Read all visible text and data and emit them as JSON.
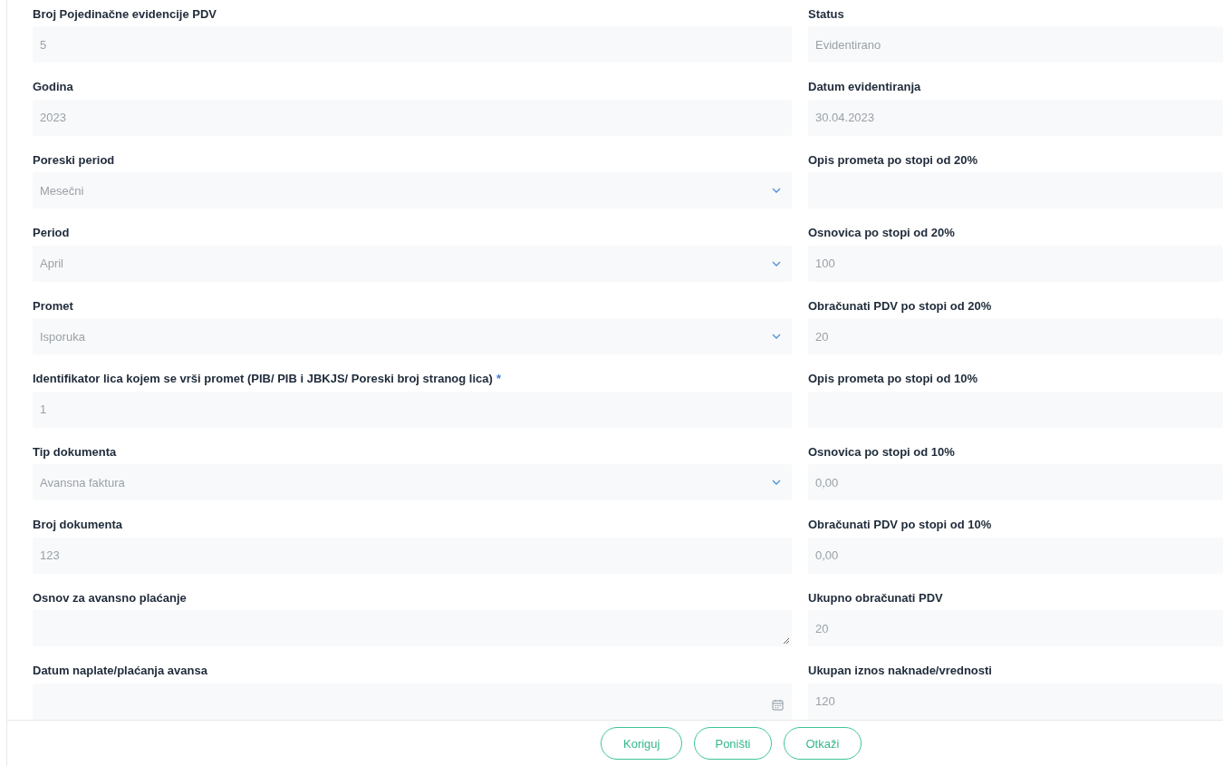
{
  "left_fields": [
    {
      "label": "Broj Pojedinačne evidencije PDV",
      "kind": "text",
      "value": "5"
    },
    {
      "label": "Godina",
      "kind": "text",
      "value": "2023"
    },
    {
      "label": "Poreski period",
      "kind": "select",
      "value": "Mesečni"
    },
    {
      "label": "Period",
      "kind": "select",
      "value": "April"
    },
    {
      "label": "Promet",
      "kind": "select",
      "value": "Isporuka"
    },
    {
      "label": "Identifikator lica kojem se vrši promet (PIB/ PIB i JBKJS/ Poreski broj stranog lica)",
      "required_mark": "*",
      "kind": "text",
      "value": "1"
    },
    {
      "label": "Tip dokumenta",
      "kind": "select",
      "value": "Avansna faktura"
    },
    {
      "label": "Broj dokumenta",
      "kind": "text",
      "value": "123"
    },
    {
      "label": "Osnov za avansno plaćanje",
      "kind": "textarea"
    },
    {
      "label": "Datum naplate/plaćanja avansa",
      "kind": "date"
    }
  ],
  "right_fields": [
    {
      "label": "Status",
      "kind": "text",
      "value": "Evidentirano"
    },
    {
      "label": "Datum evidentiranja",
      "kind": "text",
      "value": "30.04.2023"
    },
    {
      "label": "Opis prometa po stopi od 20%",
      "kind": "text"
    },
    {
      "label": "Osnovica po stopi od 20%",
      "kind": "text",
      "value": "100"
    },
    {
      "label": "Obračunati PDV po stopi od 20%",
      "kind": "text",
      "value": "20"
    },
    {
      "label": "Opis prometa po stopi od 10%",
      "kind": "text"
    },
    {
      "label": "Osnovica po stopi od 10%",
      "kind": "text",
      "value": "0,00"
    },
    {
      "label": "Obračunati PDV po stopi od 10%",
      "kind": "text",
      "value": "0,00"
    },
    {
      "label": "Ukupno obračunati PDV",
      "kind": "text",
      "value": "20"
    },
    {
      "label": "Ukupan iznos naknade/vrednosti",
      "kind": "text",
      "value": "120"
    }
  ],
  "buttons": [
    {
      "label": "Koriguj"
    },
    {
      "label": "Poništi"
    },
    {
      "label": "Otkaži"
    }
  ]
}
